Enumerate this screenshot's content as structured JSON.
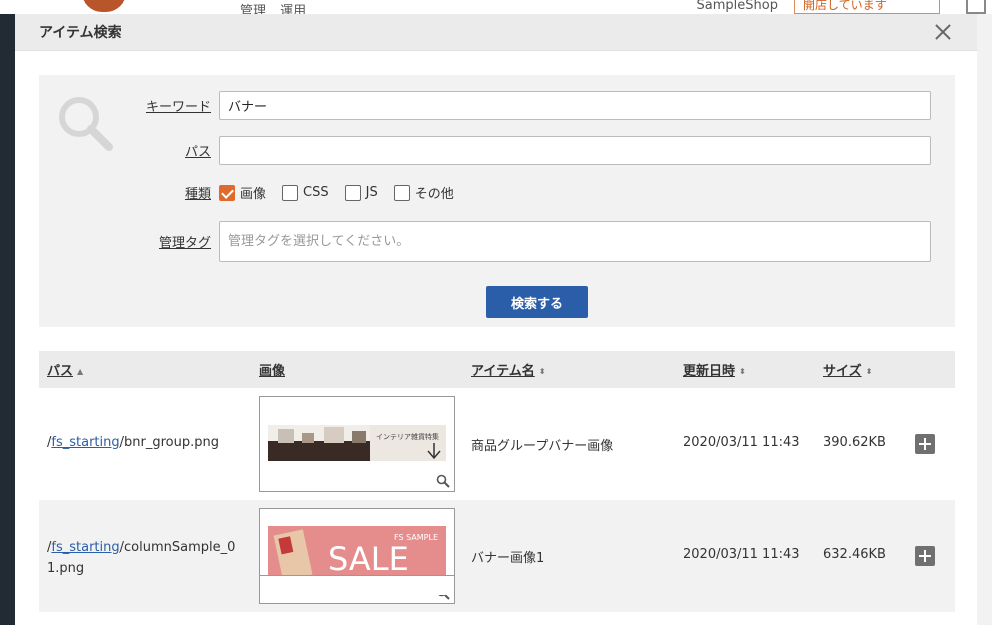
{
  "background": {
    "nav_items": [
      "管理",
      "運用"
    ],
    "shop_name": "SampleShop",
    "status": "開店しています"
  },
  "modal": {
    "title": "アイテム検索"
  },
  "search": {
    "keyword_label": "キーワード",
    "keyword_value": "バナー",
    "path_label": "パス",
    "path_value": "",
    "type_label": "種類",
    "types": [
      {
        "label": "画像",
        "checked": true
      },
      {
        "label": "CSS",
        "checked": false
      },
      {
        "label": "JS",
        "checked": false
      },
      {
        "label": "その他",
        "checked": false
      }
    ],
    "tag_label": "管理タグ",
    "tag_placeholder": "管理タグを選択してください。",
    "submit_label": "検索する"
  },
  "table": {
    "headers": {
      "path": "パス",
      "image": "画像",
      "name": "アイテム名",
      "updated": "更新日時",
      "size": "サイズ"
    },
    "rows": [
      {
        "path_prefix": "/",
        "path_link": "fs_starting",
        "path_rest": "/bnr_group.png",
        "thumb_text": "インテリア雑貨特集",
        "name": "商品グループバナー画像",
        "updated": "2020/03/11 11:43",
        "size": "390.62KB"
      },
      {
        "path_prefix": "/",
        "path_link": "fs_starting",
        "path_rest": "/columnSample_01.png",
        "thumb_text": "SALE",
        "thumb_subtext": "FS SAMPLE",
        "name": "バナー画像1",
        "updated": "2020/03/11 11:43",
        "size": "632.46KB"
      }
    ]
  },
  "colors": {
    "accent": "#2a5ea8",
    "check": "#e06a2c",
    "header_bg": "#ebebeb",
    "panel_bg": "#f2f2f2"
  }
}
